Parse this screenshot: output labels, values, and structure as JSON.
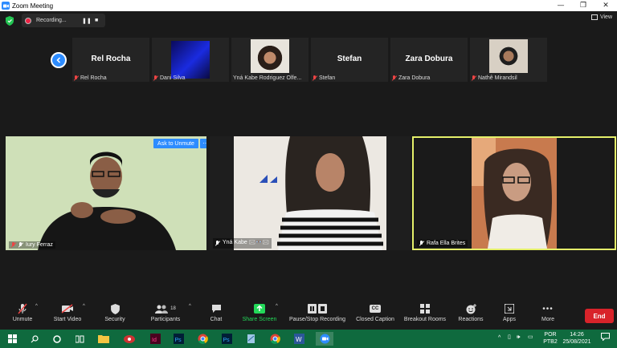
{
  "window": {
    "title": "Zoom Meeting",
    "minimize": "—",
    "restore": "❐",
    "close": "✕"
  },
  "recording": {
    "label": "Recording...",
    "pause": "❚❚",
    "stop": "■"
  },
  "view_label": "View",
  "thumbnails": [
    {
      "name": "Rel Rocha",
      "caption": "Rel Rocha",
      "video": false
    },
    {
      "name": "",
      "caption": "Dani Silva",
      "video": true
    },
    {
      "name": "",
      "caption": "Yná Kabe Rodriguez Olfe...",
      "video": true
    },
    {
      "name": "Stefan",
      "caption": "Stefan",
      "video": false
    },
    {
      "name": "Zara Dobura",
      "caption": "Zara Dobura",
      "video": false
    },
    {
      "name": "",
      "caption": "Nathê Mirandsil",
      "video": true
    }
  ],
  "tiles": [
    {
      "caption": "Iury Ferraz",
      "ask_label": "Ask to Unmute",
      "more_label": "···"
    },
    {
      "caption": "Yná Kabe 🖂👓🖂"
    },
    {
      "caption": "Rafa Ella Brites"
    }
  ],
  "toolbar": {
    "unmute": "Unmute",
    "start_video": "Start Video",
    "security": "Security",
    "participants": "Participants",
    "participants_count": "18",
    "chat": "Chat",
    "share_screen": "Share Screen",
    "record": "Pause/Stop Recording",
    "captions": "Closed Caption",
    "cc_badge": "CC",
    "breakout": "Breakout Rooms",
    "reactions": "Reactions",
    "apps": "Apps",
    "more": "More",
    "end": "End"
  },
  "taskbar": {
    "lang_top": "POR",
    "lang_bottom": "PTB2",
    "time": "14:26",
    "date": "25/08/2021"
  },
  "colors": {
    "accent": "#2d8cff",
    "end": "#d8232a",
    "active_speaker": "#e5f06a",
    "share_green": "#23d959",
    "taskbar": "#0f6a3e"
  }
}
